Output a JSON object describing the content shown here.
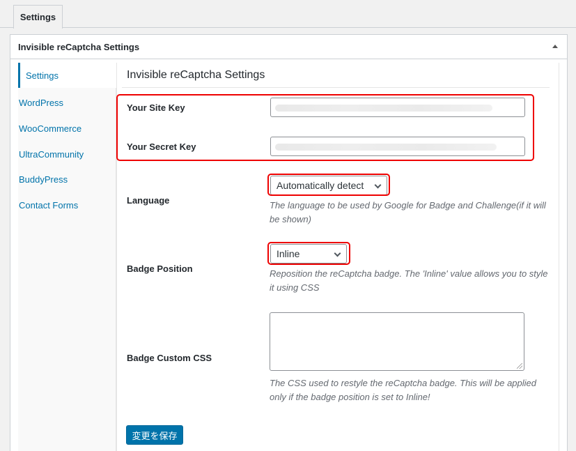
{
  "tabs": [
    {
      "label": "Settings"
    }
  ],
  "panel": {
    "title": "Invisible reCaptcha Settings"
  },
  "sidebar": {
    "items": [
      {
        "label": "Settings"
      },
      {
        "label": "WordPress"
      },
      {
        "label": "WooCommerce"
      },
      {
        "label": "UltraCommunity"
      },
      {
        "label": "BuddyPress"
      },
      {
        "label": "Contact Forms"
      }
    ]
  },
  "main": {
    "section_title": "Invisible reCaptcha Settings",
    "site_key_label": "Your Site Key",
    "secret_key_label": "Your Secret Key",
    "language_label": "Language",
    "language_value": "Automatically detect",
    "language_desc": "The language to be used by Google for Badge and Challenge(if it will be shown)",
    "badge_position_label": "Badge Position",
    "badge_position_value": "Inline",
    "badge_position_desc": "Reposition the reCaptcha badge. The 'Inline' value allows you to style it using CSS",
    "badge_css_label": "Badge Custom CSS",
    "badge_css_desc": "The CSS used to restyle the reCaptcha badge. This will be applied only if the badge position is set to Inline!",
    "save_label": "変更を保存"
  },
  "colors": {
    "accent": "#0073aa",
    "highlight": "#ee0000"
  },
  "icons": {
    "toggle": "triangle-up-icon",
    "select": "chevron-down-icon"
  }
}
